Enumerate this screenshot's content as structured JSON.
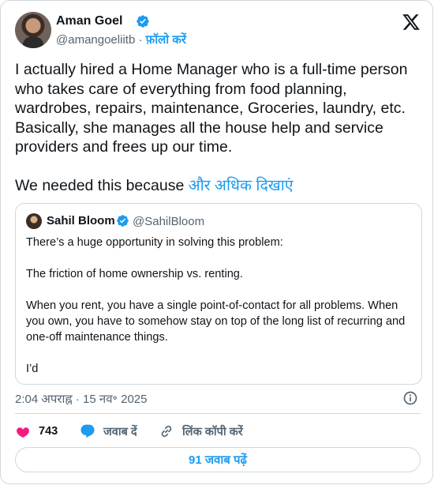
{
  "author": {
    "name": "Aman Goel",
    "handle": "@amangoeliitb",
    "separator": "·",
    "follow_label": "फ़ॉलो करें"
  },
  "tweet": {
    "paragraph1": "I actually hired a Home Manager who is a full-time person who takes care of everything from food planning, wardrobes, repairs, maintenance, Groceries, laundry, etc. Basically, she manages all the house help and service providers and frees up our time.",
    "paragraph2_prefix": "We needed this because ",
    "show_more": "और अधिक दिखाएं"
  },
  "quote": {
    "name": "Sahil Bloom",
    "handle": "@SahilBloom",
    "lines": [
      "There’s a huge opportunity in solving this problem:",
      "The friction of home ownership vs. renting.",
      "When you rent, you have a single point-of-contact for all problems. When you own, you have to somehow stay on top of the long list of recurring and one-off maintenance things.",
      "I’d"
    ]
  },
  "meta": {
    "timestamp": "2:04 अपराह्न · 15 नव॰ 2025"
  },
  "actions": {
    "like_count": "743",
    "reply_label": "जवाब दें",
    "copy_link_label": "लिंक कॉपी करें"
  },
  "replies_button": "91 जवाब पढ़ें",
  "colors": {
    "accent": "#1d9bf0",
    "like": "#f91880",
    "text": "#0f1419",
    "muted": "#536471",
    "border": "#cfd9de"
  },
  "icons": [
    "verified-badge-icon",
    "x-logo-icon",
    "info-icon",
    "heart-icon",
    "reply-bubble-icon",
    "link-icon"
  ]
}
